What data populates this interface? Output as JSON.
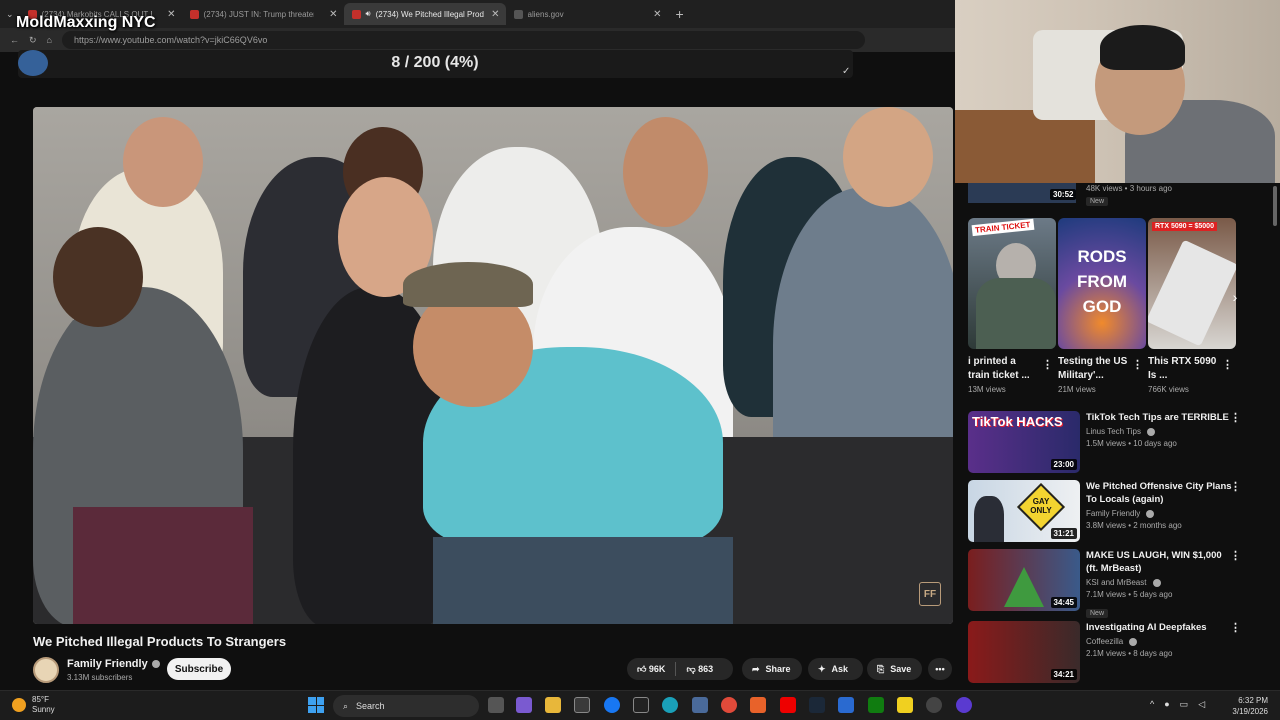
{
  "overlay_title": "MoldMaxxing NYC",
  "counter": "8 / 200 (4%)",
  "browser": {
    "tabs": [
      {
        "label": "(2734) Markobits CALLS OUT Eric",
        "active": false
      },
      {
        "label": "(2734) JUST IN: Trump threatens ...",
        "active": false
      },
      {
        "label": "(2734) We Pitched Illegal Prod",
        "active": true
      },
      {
        "label": "aliens.gov",
        "active": false
      }
    ],
    "new_tab": "+",
    "url": "https://www.youtube.com/watch?v=jkiC66QV6vo"
  },
  "video": {
    "title": "We Pitched Illegal Products To Strangers",
    "watermark": "FF",
    "channel": {
      "name": "Family Friendly",
      "subscribers": "3.13M subscribers",
      "subscribe_label": "Subscribe"
    },
    "actions": {
      "likes": "96K",
      "dislikes": "863",
      "share": "Share",
      "ask": "Ask",
      "save": "Save",
      "more": "•••"
    }
  },
  "sidebar": {
    "top_item": {
      "duration": "30:52",
      "meta": "48K views • 3 hours ago",
      "badge": "New"
    },
    "shorts": [
      {
        "title": "i printed a train ticket ...",
        "views": "13M views",
        "thumb_text": "TRAIN TICKET"
      },
      {
        "title": "Testing the US Military'...",
        "views": "21M views",
        "thumb_text": "RODS FROM GOD"
      },
      {
        "title": "This RTX 5090 Is ...",
        "views": "766K views",
        "thumb_text": "RTX 5090 = $5000"
      }
    ],
    "videos": [
      {
        "title": "TikTok Tech Tips are TERRIBLE",
        "channel": "Linus Tech Tips",
        "meta": "1.5M views • 10 days ago",
        "duration": "23:00",
        "badge": "",
        "thumb_text": "TikTok HACKS"
      },
      {
        "title": "We Pitched Offensive City Plans To Locals (again)",
        "channel": "Family Friendly",
        "meta": "3.8M views • 2 months ago",
        "duration": "31:21",
        "badge": "",
        "thumb_text": "GAY ONLY"
      },
      {
        "title": "MAKE US LAUGH, WIN $1,000 (ft. MrBeast)",
        "channel": "KSI and MrBeast",
        "meta": "7.1M views • 5 days ago",
        "duration": "34:45",
        "badge": "New",
        "thumb_text": ""
      },
      {
        "title": "Investigating AI Deepfakes",
        "channel": "Coffeezilla",
        "meta": "2.1M views • 8 days ago",
        "duration": "34:21",
        "badge": "",
        "thumb_text": ""
      }
    ]
  },
  "taskbar": {
    "weather_temp": "85°F",
    "weather_desc": "Sunny",
    "search_label": "Search",
    "time": "6:32 PM",
    "date": "3/19/2026"
  }
}
